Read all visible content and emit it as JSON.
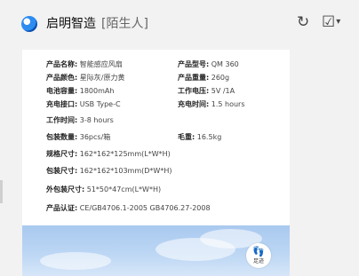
{
  "header": {
    "title": "启明智造",
    "tag": "[陌生人]",
    "sync_icon": "↻",
    "check_icon": "☑",
    "caret": "▾"
  },
  "specs": {
    "name_label": "产品名称:",
    "name_value": "智能感应风扇",
    "model_label": "产品型号:",
    "model_value": "QM 360",
    "color_label": "产品颜色:",
    "color_value": "星际灰/原力黄",
    "weight_label": "产品重量:",
    "weight_value": "260g",
    "battery_label": "电池容量:",
    "battery_value": "1800mAh",
    "voltage_label": "工作电压:",
    "voltage_value": "5V /1A",
    "port_label": "充电接口:",
    "port_value": "USB Type-C",
    "charge_label": "充电时间:",
    "charge_value": "1.5 hours",
    "worktime_label": "工作时间:",
    "worktime_value": "3-8 hours",
    "pack_label": "包装数量:",
    "pack_value": "36pcs/箱",
    "gross_label": "毛重:",
    "gross_value": "16.5kg",
    "size_label": "规格尺寸:",
    "size_value": "162*162*125mm(L*W*H)",
    "pkgsize_label": "包装尺寸:",
    "pkgsize_value": "162*162*103mm(D*W*H)",
    "outer_label": "外包装尺寸:",
    "outer_value": "51*50*47cm(L*W*H)",
    "cert_label": "产品认证:",
    "cert_value": "CE/GB4706.1-2005 GB4706.27-2008"
  },
  "footprint": {
    "icon": "👣",
    "label": "足迹"
  }
}
